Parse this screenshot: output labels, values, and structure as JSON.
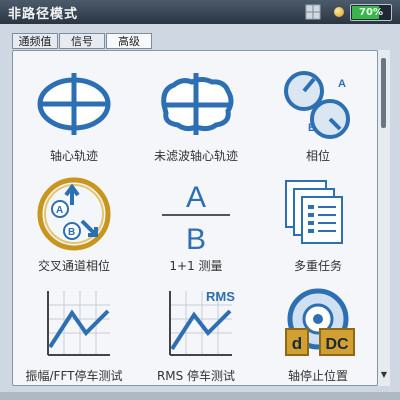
{
  "window": {
    "title": "非路径模式"
  },
  "status": {
    "battery_text": "70%",
    "battery_level": 0.7
  },
  "tabs": [
    {
      "label": "通频值",
      "active": false
    },
    {
      "label": "信号",
      "active": false
    },
    {
      "label": "高级",
      "active": true
    }
  ],
  "tiles": [
    {
      "label": "轴心轨迹",
      "icon": "orbit-icon"
    },
    {
      "label": "未滤波轴心轨迹",
      "icon": "unfiltered-orbit-icon"
    },
    {
      "label": "相位",
      "icon": "phase-icon"
    },
    {
      "label": "交叉通道相位",
      "icon": "cross-channel-phase-icon"
    },
    {
      "label": "1+1 测量",
      "icon": "a-over-b-icon",
      "icon_text": [
        "A",
        "B"
      ]
    },
    {
      "label": "多重任务",
      "icon": "multi-task-icon"
    },
    {
      "label": "振幅/FFT停车测试",
      "icon": "amplitude-fft-chart-icon"
    },
    {
      "label": "RMS 停车测试",
      "icon": "rms-chart-icon",
      "icon_text": [
        "RMS"
      ]
    },
    {
      "label": "轴停止位置",
      "icon": "shaft-stop-position-icon",
      "icon_text": [
        "d",
        "DC"
      ]
    }
  ],
  "colors": {
    "accent_blue": "#2d6fb3",
    "gold": "#c8961e",
    "titlebar": "#2f3b48"
  }
}
